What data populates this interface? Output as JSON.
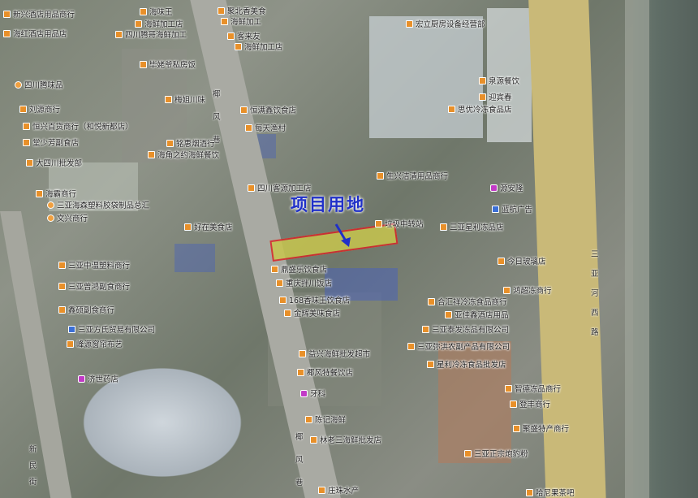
{
  "annotation": {
    "title": "项目用地",
    "color": "#2030c8"
  },
  "site": {
    "fill": "#c8c64e",
    "stroke": "#d8242a"
  },
  "roads": {
    "east_road": [
      "三",
      "亚",
      "河",
      "西",
      "路"
    ],
    "alley": [
      "椰",
      "风",
      "巷"
    ],
    "alley_lower": [
      "椰",
      "风",
      "巷"
    ],
    "west_street": [
      "新",
      "民",
      "街"
    ]
  },
  "pois": [
    {
      "t": "新兴酒店用品商行"
    },
    {
      "t": "海红酒店用品店"
    },
    {
      "t": "四川腾味品"
    },
    {
      "t": "刘源商行"
    },
    {
      "t": "恒兴百货商行（和悦新都店）"
    },
    {
      "t": "堂少芳副食店"
    },
    {
      "t": "大四川批发部"
    },
    {
      "t": "海霸商行"
    },
    {
      "t": "三亚海森塑料胶袋制品总汇"
    },
    {
      "t": "文兴商行"
    },
    {
      "t": "三亚中温塑料商行"
    },
    {
      "t": "三亚曾鸿副食商行"
    },
    {
      "t": "鑫硕副食商行"
    },
    {
      "t": "三亚方氏贸易有限公司"
    },
    {
      "t": "峰源窗帘布艺"
    },
    {
      "t": "济世药店"
    },
    {
      "t": "海味王"
    },
    {
      "t": "海鲜加工店"
    },
    {
      "t": "四川腾哥海鲜加工"
    },
    {
      "t": "毕姥爷私房饭"
    },
    {
      "t": "梅姐川味"
    },
    {
      "t": "铭惠烟酒行"
    },
    {
      "t": "海角之约海鲜餐饮"
    },
    {
      "t": "四川客源加工店"
    },
    {
      "t": "好在美食店"
    },
    {
      "t": "聚北香美食"
    },
    {
      "t": "海鲜加工"
    },
    {
      "t": "客来友"
    },
    {
      "t": "海鲜加工店"
    },
    {
      "t": "恒满鑫饮食店"
    },
    {
      "t": "每天渔村"
    },
    {
      "t": "宏立厨房设备经营部"
    },
    {
      "t": "泉源餐饮"
    },
    {
      "t": "迎宾春"
    },
    {
      "t": "思优冷冻食品店"
    },
    {
      "t": "生兴洁清用品商行"
    },
    {
      "t": "源安隆"
    },
    {
      "t": "蓝航广告"
    },
    {
      "t": "垃圾中转站"
    },
    {
      "t": "三亚星利冻品店"
    },
    {
      "t": "今日玻璃店"
    },
    {
      "t": "鼎盛乐饮食店"
    },
    {
      "t": "重庆拌川饭店"
    },
    {
      "t": "168香味王饮食店"
    },
    {
      "t": "金辉美味食店"
    },
    {
      "t": "益兴海鲜批发超市"
    },
    {
      "t": "椰风特餐饮店"
    },
    {
      "t": "牙科"
    },
    {
      "t": "陈记海鲜"
    },
    {
      "t": "林老三海鲜批发店"
    },
    {
      "t": "庄珠水产"
    },
    {
      "t": "鸿超冻商行"
    },
    {
      "t": "合汇祥冷冻食品商行"
    },
    {
      "t": "亚佳鑫酒店用品"
    },
    {
      "t": "三亚泰发冻品有限公司"
    },
    {
      "t": "三亚弥洪农副产品有限公司"
    },
    {
      "t": "星利冷冻食品批发店"
    },
    {
      "t": "智德冻品商行"
    },
    {
      "t": "登丰商行"
    },
    {
      "t": "聚盛特产商行"
    },
    {
      "t": "三亚正宗炮豹粉"
    },
    {
      "t": "哈尼果茶吧"
    }
  ]
}
